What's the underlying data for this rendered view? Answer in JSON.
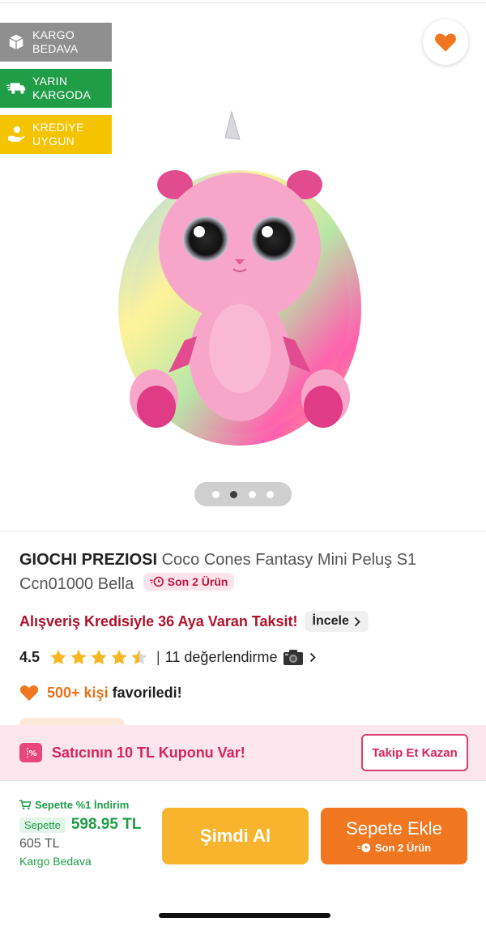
{
  "badges": {
    "cargo_free": "KARGO BEDAVA",
    "tomorrow_cargo": "YARIN KARGODA",
    "credit_eligible": "KREDİYE UYGUN"
  },
  "colors": {
    "brand_orange": "#f0771f",
    "buy_now_yellow": "#f7b42c",
    "green": "#1f9d47",
    "credit_red": "#b1122a",
    "coupon_pink": "#d8245a"
  },
  "gallery": {
    "image_count": 4,
    "active_index": 1
  },
  "product": {
    "brand": "GIOCHI PREZIOSI",
    "name": "Coco Cones Fantasy Mini Peluş S1 Ccn01000 Bella",
    "stock_tag": "Son 2 Ürün"
  },
  "credit": {
    "text": "Alışveriş Kredisiyle 36 Aya Varan Taksit!",
    "link_label": "İncele"
  },
  "rating": {
    "value": "4.5",
    "stars": 4.5,
    "reviews_text": "11 değerlendirme"
  },
  "favorites": {
    "count": "500+ kişi",
    "suffix": "favoriledi!"
  },
  "coupon": {
    "text": "Satıcının 10 TL Kuponu Var!",
    "button_label": "Takip Et Kazan"
  },
  "bottom": {
    "cart_discount": "Sepette %1 İndirim",
    "cart_tag": "Sepette",
    "cart_price": "598.95 TL",
    "old_price": "605 TL",
    "free_shipping": "Kargo Bedava",
    "buy_now_label": "Şimdi Al",
    "add_to_cart_label": "Sepete Ekle",
    "add_to_cart_sub": "Son 2 Ürün"
  }
}
